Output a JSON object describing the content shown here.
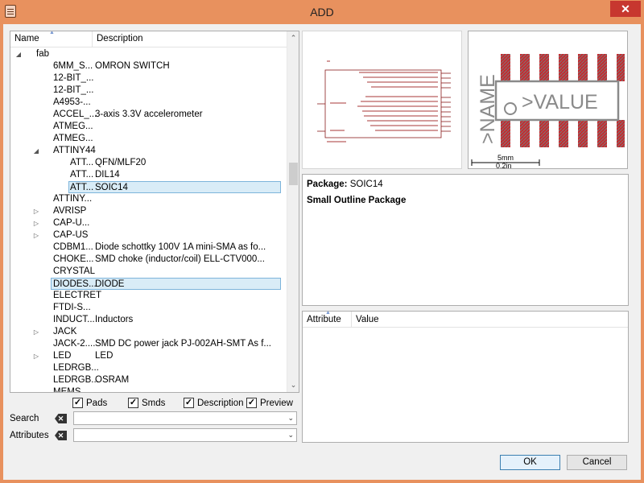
{
  "window": {
    "title": "ADD",
    "close_label": "✕"
  },
  "tree": {
    "columns": {
      "name": "Name",
      "description": "Description"
    },
    "rows": [
      {
        "name": "fab",
        "desc": "",
        "level": 0,
        "toggle": "expanded"
      },
      {
        "name": "6MM_S...",
        "desc": "OMRON SWITCH",
        "level": 1,
        "toggle": ""
      },
      {
        "name": "12-BIT_...",
        "desc": "",
        "level": 1,
        "toggle": ""
      },
      {
        "name": "12-BIT_...",
        "desc": "",
        "level": 1,
        "toggle": ""
      },
      {
        "name": "A4953-...",
        "desc": "",
        "level": 1,
        "toggle": ""
      },
      {
        "name": "ACCEL_...",
        "desc": "3-axis 3.3V accelerometer",
        "level": 1,
        "toggle": ""
      },
      {
        "name": "ATMEG...",
        "desc": "",
        "level": 1,
        "toggle": ""
      },
      {
        "name": "ATMEG...",
        "desc": "",
        "level": 1,
        "toggle": ""
      },
      {
        "name": "ATTINY44",
        "desc": "",
        "level": 1,
        "toggle": "expanded"
      },
      {
        "name": "ATT...",
        "desc": "QFN/MLF20",
        "level": 2,
        "toggle": ""
      },
      {
        "name": "ATT...",
        "desc": "DIL14",
        "level": 2,
        "toggle": ""
      },
      {
        "name": "ATT...",
        "desc": "SOIC14",
        "level": 2,
        "toggle": "",
        "selected": true
      },
      {
        "name": "ATTINY...",
        "desc": "",
        "level": 1,
        "toggle": ""
      },
      {
        "name": "AVRISP",
        "desc": "",
        "level": 1,
        "toggle": "collapsed"
      },
      {
        "name": "CAP-U...",
        "desc": "",
        "level": 1,
        "toggle": "collapsed"
      },
      {
        "name": "CAP-US",
        "desc": "",
        "level": 1,
        "toggle": "collapsed"
      },
      {
        "name": "CDBM1...",
        "desc": "Diode schottky 100V 1A mini-SMA as fo...",
        "level": 1,
        "toggle": ""
      },
      {
        "name": "CHOKE...",
        "desc": "SMD choke (inductor/coil) ELL-CTV000...",
        "level": 1,
        "toggle": ""
      },
      {
        "name": "CRYSTAL",
        "desc": "",
        "level": 1,
        "toggle": ""
      },
      {
        "name": "DIODES...",
        "desc": "DIODE",
        "level": 1,
        "toggle": "",
        "selected": true
      },
      {
        "name": "ELECTRET",
        "desc": "",
        "level": 1,
        "toggle": ""
      },
      {
        "name": "FTDI-S...",
        "desc": "",
        "level": 1,
        "toggle": ""
      },
      {
        "name": "INDUCT...",
        "desc": "Inductors",
        "level": 1,
        "toggle": ""
      },
      {
        "name": "JACK",
        "desc": "",
        "level": 1,
        "toggle": "collapsed"
      },
      {
        "name": "JACK-2....",
        "desc": "SMD DC power jack PJ-002AH-SMT As f...",
        "level": 1,
        "toggle": ""
      },
      {
        "name": "LED",
        "desc": "LED",
        "level": 1,
        "toggle": "collapsed"
      },
      {
        "name": "LEDRGB...",
        "desc": "",
        "level": 1,
        "toggle": ""
      },
      {
        "name": "LEDRGB...",
        "desc": "OSRAM",
        "level": 1,
        "toggle": ""
      },
      {
        "name": "MEMS ...",
        "desc": "",
        "level": 1,
        "toggle": ""
      }
    ]
  },
  "options": {
    "pads": "Pads",
    "smds": "Smds",
    "description": "Description",
    "preview": "Preview",
    "all_checked": true
  },
  "search": {
    "label": "Search",
    "value": ""
  },
  "attributes_filter": {
    "label": "Attributes",
    "value": ""
  },
  "package_preview": {
    "name_label": ">NAME",
    "value_label": ">VALUE",
    "scale_mm": "5mm",
    "scale_in": "0.2in"
  },
  "description_panel": {
    "package_label": "Package:",
    "package_value": "SOIC14",
    "package_desc": "Small Outline Package"
  },
  "attribute_table": {
    "col_attribute": "Attribute",
    "col_value": "Value"
  },
  "buttons": {
    "ok": "OK",
    "cancel": "Cancel"
  },
  "colors": {
    "titlebar": "#e8915e",
    "close": "#c7372f",
    "pad": "#c8282d",
    "pad_hatch": "#7a7a7a",
    "selection": "#d9ecf7",
    "schematic": "#8a1c1c"
  }
}
